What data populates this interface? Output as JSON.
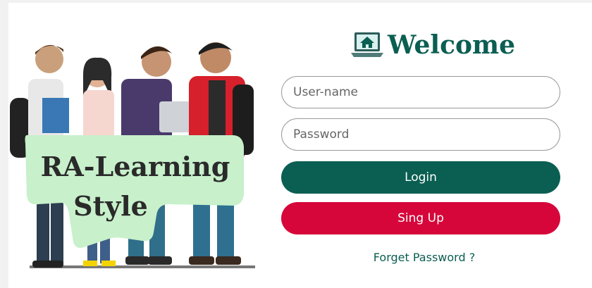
{
  "header": {
    "title": "Welcome",
    "icon": "laptop-home-icon"
  },
  "illustration": {
    "text_line1": "RA-Learning",
    "text_line2": "Style",
    "icon": "students-illustration"
  },
  "form": {
    "username_placeholder": "User-name",
    "password_placeholder": "Password",
    "login_label": "Login",
    "signup_label": "Sing Up",
    "forgot_label": "Forget Password ?"
  },
  "colors": {
    "primary": "#0b5e52",
    "signup": "#d6063a",
    "note_green": "#c7f0cb"
  }
}
